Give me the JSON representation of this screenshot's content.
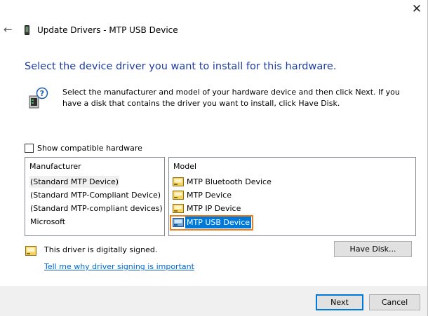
{
  "window": {
    "title": "Update Drivers - MTP USB Device",
    "close_glyph": "✕",
    "back_glyph": "←"
  },
  "heading": "Select the device driver you want to install for this hardware.",
  "instruction": "Select the manufacturer and model of your hardware device and then click Next. If you have a disk that contains the driver you want to install, click Have Disk.",
  "compatible_checkbox": {
    "label": "Show compatible hardware",
    "checked": false
  },
  "manufacturer_list": {
    "header": "Manufacturer",
    "items": [
      "(Standard MTP Device)",
      "(Standard MTP-Compliant Device)",
      "(Standard MTP-compliant devices)",
      "Microsoft"
    ],
    "selected_index": 0
  },
  "model_list": {
    "header": "Model",
    "items": [
      "MTP Bluetooth Device",
      "MTP Device",
      "MTP IP Device",
      "MTP USB Device"
    ],
    "selected_index": 3
  },
  "signature": {
    "text": "This driver is digitally signed.",
    "link": "Tell me why driver signing is important"
  },
  "buttons": {
    "have_disk": "Have Disk...",
    "next": "Next",
    "cancel": "Cancel"
  },
  "colors": {
    "heading": "#1e3ea8",
    "selection": "#0078d7",
    "highlight_box": "#f07f1e",
    "link": "#0066cc"
  }
}
